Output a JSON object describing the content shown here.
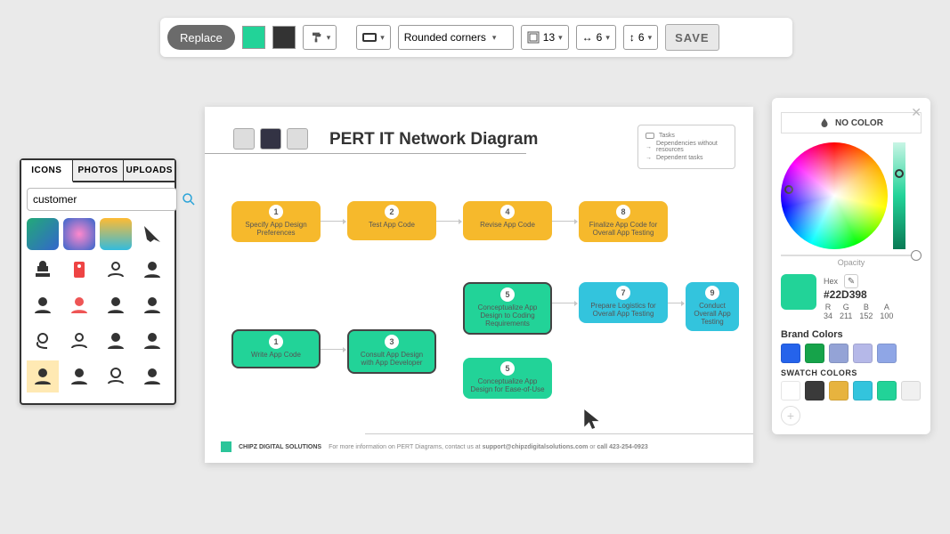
{
  "toolbar": {
    "replace_label": "Replace",
    "fill_color": "#22d398",
    "stroke_color": "#333333",
    "shape_label": "Rounded corners",
    "val13": "13",
    "val6a": "6",
    "val6b": "6",
    "save_label": "SAVE"
  },
  "icons_panel": {
    "tabs": [
      "ICONS",
      "PHOTOS",
      "UPLOADS"
    ],
    "active_tab": 0,
    "search_value": "customer"
  },
  "canvas": {
    "title": "PERT IT Network Diagram",
    "legend": [
      "Tasks",
      "Dependencies without resources",
      "Dependent tasks"
    ],
    "footer_company": "CHIPZ DIGITAL SOLUTIONS",
    "footer_text_a": "For more information on PERT Diagrams, contact us at ",
    "footer_email": "support@chipzdigitalsolutions.com",
    "footer_text_b": " or ",
    "footer_call": "call 423-254-0923",
    "nodes": {
      "y1": {
        "n": "1",
        "t": "Specify App Design Preferences"
      },
      "y2": {
        "n": "2",
        "t": "Test App Code"
      },
      "y4": {
        "n": "4",
        "t": "Revise App Code"
      },
      "y8": {
        "n": "8",
        "t": "Finalize App Code for Overall App Testing"
      },
      "g1": {
        "n": "1",
        "t": "Write App Code"
      },
      "g3": {
        "n": "3",
        "t": "Consult App Design with App Developer"
      },
      "g5a": {
        "n": "5",
        "t": "Conceptualize App Design to Coding Requirements"
      },
      "g5b": {
        "n": "5",
        "t": "Conceptualize App Design for Ease-of-Use"
      },
      "b7": {
        "n": "7",
        "t": "Prepare Logistics for Overall App Testing"
      },
      "b9": {
        "n": "9",
        "t": "Conduct Overall App Testing"
      }
    }
  },
  "color_panel": {
    "no_color": "NO COLOR",
    "opacity_label": "Opacity",
    "hex_label": "Hex",
    "hex_value": "#22D398",
    "r_lbl": "R",
    "g_lbl": "G",
    "b_lbl": "B",
    "a_lbl": "A",
    "r": "34",
    "g": "211",
    "b": "152",
    "a": "100",
    "brand_label": "Brand Colors",
    "brand_colors": [
      "#2563eb",
      "#16a34a",
      "#94a3d6",
      "#b5b8e8",
      "#8fa6e6"
    ],
    "swatch_label": "SWATCH COLORS",
    "swatch_colors": [
      "#ffffff",
      "#3a3a3a",
      "#e7b33e",
      "#33c4dd",
      "#22d398",
      "#f0f0f0"
    ]
  }
}
